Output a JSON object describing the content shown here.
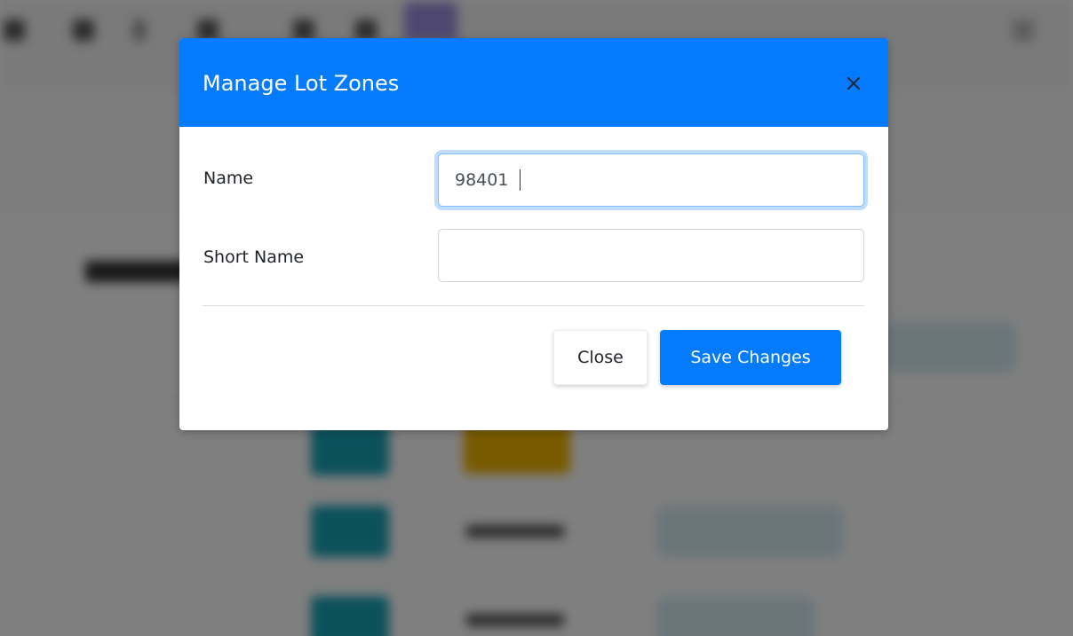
{
  "modal": {
    "title": "Manage Lot Zones",
    "close_icon": "close-icon",
    "fields": [
      {
        "label": "Name",
        "value": "98401",
        "placeholder": ""
      },
      {
        "label": "Short Name",
        "value": "",
        "placeholder": ""
      }
    ],
    "buttons": {
      "close_label": "Close",
      "save_label": "Save Changes"
    }
  },
  "colors": {
    "header": "#037bfc",
    "primary_button": "#037bfc",
    "backdrop": "rgba(0,0,0,0.5)"
  }
}
